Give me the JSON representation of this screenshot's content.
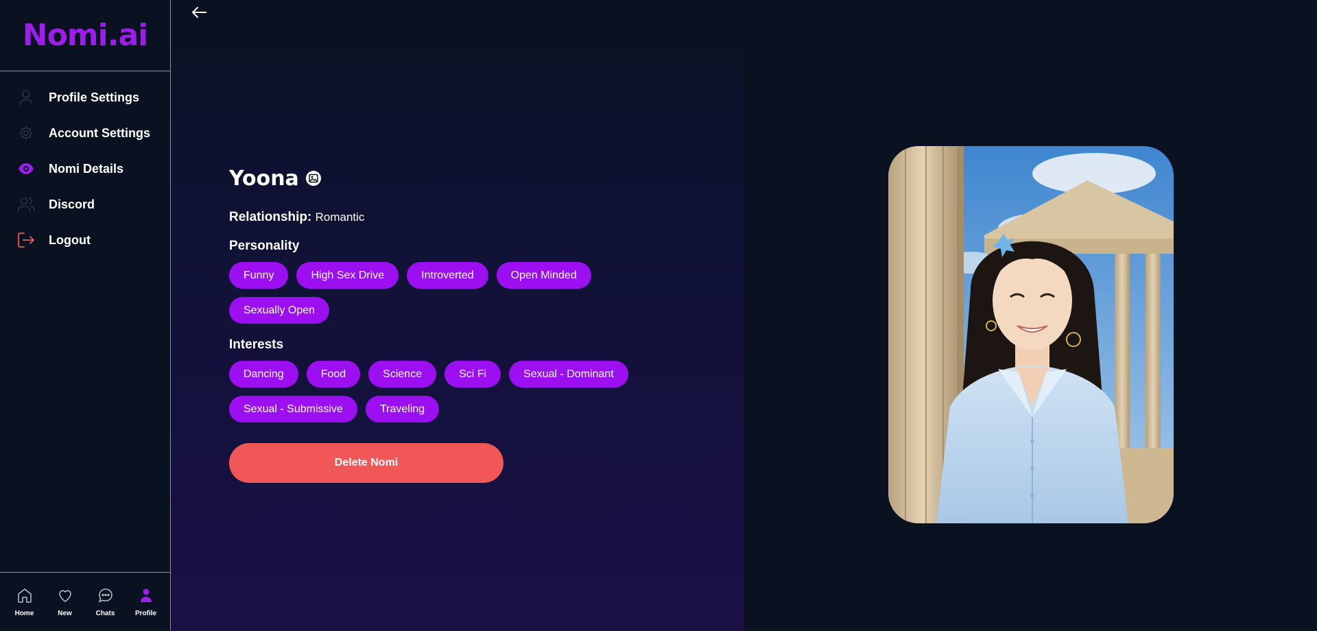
{
  "brand": {
    "name": "Nomi.ai",
    "color": "#9b1fe8"
  },
  "sidebar": {
    "items": [
      {
        "label": "Profile Settings",
        "icon": "user-icon"
      },
      {
        "label": "Account Settings",
        "icon": "gear-icon"
      },
      {
        "label": "Nomi Details",
        "icon": "eye-icon",
        "active": true
      },
      {
        "label": "Discord",
        "icon": "users-icon"
      },
      {
        "label": "Logout",
        "icon": "logout-icon"
      }
    ]
  },
  "bottom_nav": [
    {
      "label": "Home",
      "icon": "home-icon"
    },
    {
      "label": "New",
      "icon": "heart-icon"
    },
    {
      "label": "Chats",
      "icon": "chat-bubble-icon"
    },
    {
      "label": "Profile",
      "icon": "profile-icon",
      "active": true
    }
  ],
  "nomi": {
    "name": "Yoona",
    "relationship_label": "Relationship:",
    "relationship_value": "Romantic",
    "personality_title": "Personality",
    "personality": [
      "Funny",
      "High Sex Drive",
      "Introverted",
      "Open Minded",
      "Sexually Open"
    ],
    "interests_title": "Interests",
    "interests": [
      "Dancing",
      "Food",
      "Science",
      "Sci Fi",
      "Sexual - Dominant",
      "Sexual - Submissive",
      "Traveling"
    ],
    "delete_label": "Delete Nomi"
  },
  "colors": {
    "accent": "#9b0ff0",
    "danger": "#f25757",
    "background": "#0a1120"
  }
}
